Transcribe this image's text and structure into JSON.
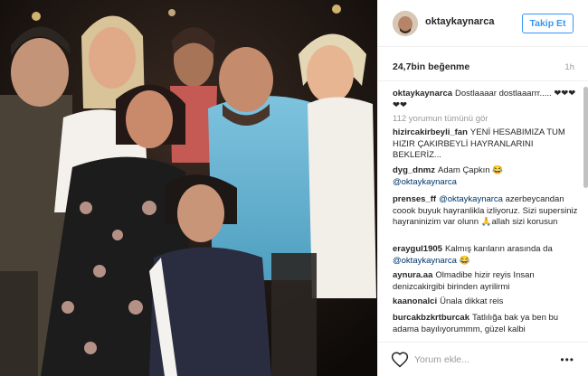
{
  "post": {
    "username": "oktaykaynarca",
    "follow_label": "Takip Et",
    "likes": "24,7bin beğenme",
    "time_ago": "1h",
    "caption_user": "oktaykaynarca",
    "caption_text": "Dostlaaaar dostlaaarrr..... ❤❤❤❤❤",
    "view_all_comments": "112 yorumun tümünü gör"
  },
  "comments": [
    {
      "user": "hizircakirbeyli_fan",
      "text": "YENİ HESABIMIZA TUM HIZIR ÇAKIRBEYLİ HAYRANLARINI BEKLERİZ..."
    },
    {
      "user": "dyg_dnmz",
      "text": "Adam Çapkın 😂",
      "mention": "@oktaykaynarca"
    },
    {
      "user": "prenses_ff",
      "mention": "@oktaykaynarca",
      "text": "azerbeycandan coook buyuk hayranlikla izliyoruz. Sizi supersiniz hayraninizim var olunn 🙏allah sizi korusun"
    },
    {
      "user": "eraygul1905",
      "text": "Kalmış karıların arasında da",
      "mention": "@oktaykaynarca 😂"
    },
    {
      "user": "aynura.aa",
      "text": "Olmadibe hizir reyis Insan denizcakirgibi birinden ayrilirmi"
    },
    {
      "user": "kaanonalci",
      "text": "Ünala dikkat reis"
    },
    {
      "user": "burcakbzkrtburcak",
      "text": "Tatlılığa bak ya ben bu adama bayılıyorummm, güzel kalbi"
    }
  ],
  "footer": {
    "comment_placeholder": "Yorum ekle...",
    "more_label": "•••"
  },
  "icons": {
    "like": "heart-outline-icon",
    "more": "more-dots-icon"
  },
  "colors": {
    "follow_blue": "#3897f0",
    "mention": "#003569",
    "muted": "#999999"
  }
}
